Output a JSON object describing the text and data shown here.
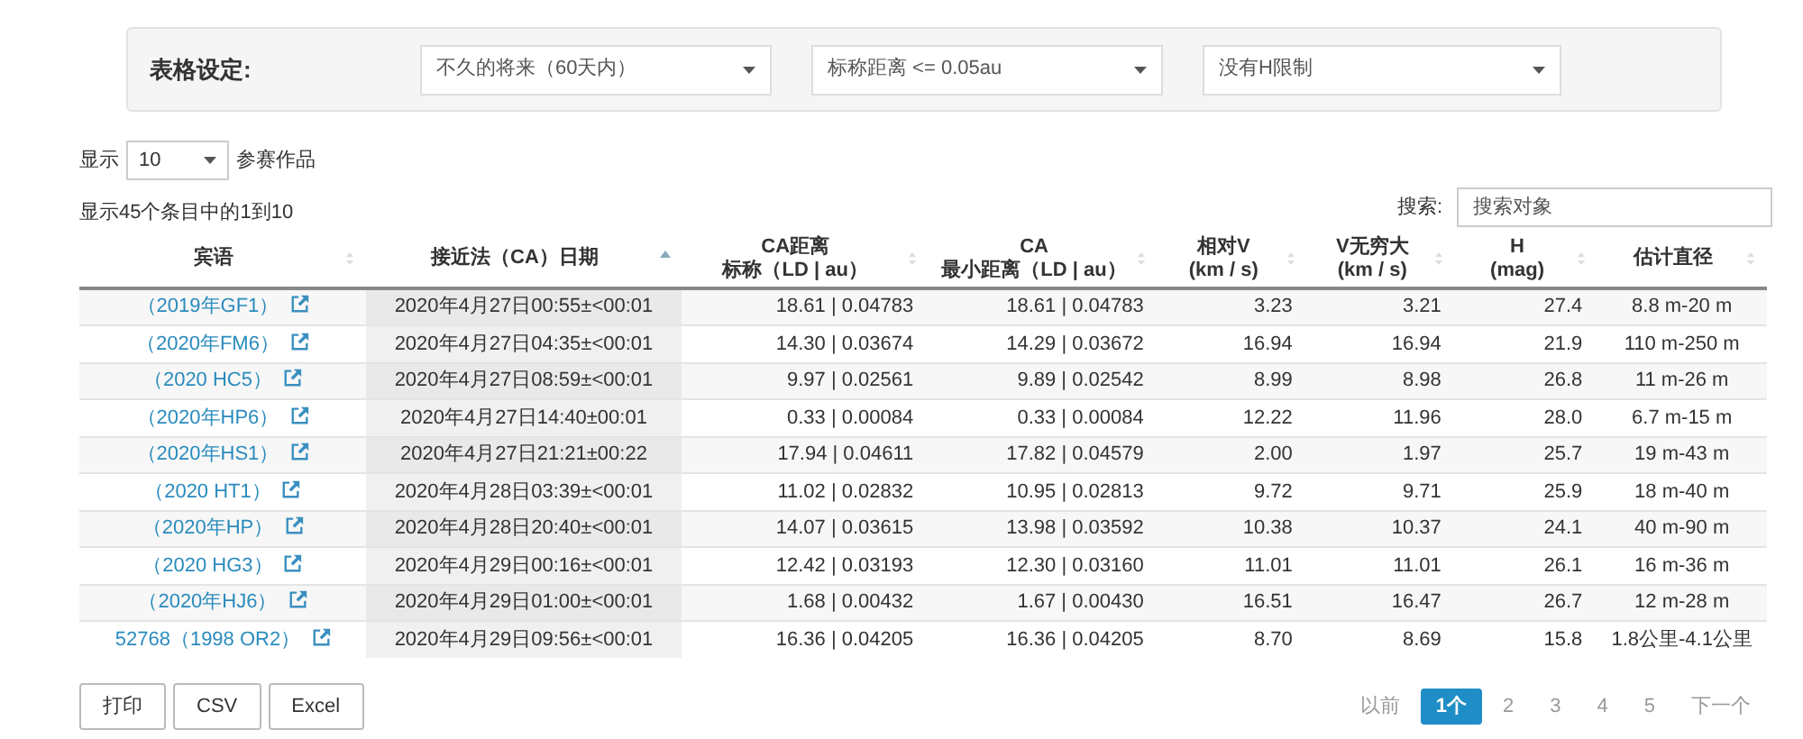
{
  "settings": {
    "label": "表格设定:",
    "selects": [
      {
        "value": "不久的将来（60天内）"
      },
      {
        "value": "标称距离 <= 0.05au"
      },
      {
        "value": "没有H限制"
      }
    ]
  },
  "length_menu": {
    "prefix": "显示",
    "value": "10",
    "suffix": "参赛作品"
  },
  "info": "显示45个条目中的1到10",
  "search": {
    "label": "搜索:",
    "placeholder": "搜索对象"
  },
  "table": {
    "columns": [
      {
        "lines": [
          "宾语"
        ],
        "sorted": false
      },
      {
        "lines": [
          "接近法（CA）日期"
        ],
        "sorted": true
      },
      {
        "lines": [
          "CA距离",
          "标称（LD | au）"
        ],
        "sorted": false
      },
      {
        "lines": [
          "CA",
          "最小距离（LD | au）"
        ],
        "sorted": false
      },
      {
        "lines": [
          "相对V",
          "(km / s)"
        ],
        "sorted": false
      },
      {
        "lines": [
          "V无穷大",
          "(km / s)"
        ],
        "sorted": false
      },
      {
        "lines": [
          "H",
          "(mag)"
        ],
        "sorted": false
      },
      {
        "lines": [
          "估计直径"
        ],
        "sorted": false
      }
    ],
    "rows": [
      [
        "（2019年GF1）",
        "2020年4月27日00:55±<00:01",
        "18.61 | 0.04783",
        "18.61 | 0.04783",
        "3.23",
        "3.21",
        "27.4",
        "8.8 m-20 m"
      ],
      [
        "（2020年FM6）",
        "2020年4月27日04:35±<00:01",
        "14.30 | 0.03674",
        "14.29 | 0.03672",
        "16.94",
        "16.94",
        "21.9",
        "110 m-250 m"
      ],
      [
        "（2020 HC5）",
        "2020年4月27日08:59±<00:01",
        "9.97 | 0.02561",
        "9.89 | 0.02542",
        "8.99",
        "8.98",
        "26.8",
        "11 m-26 m"
      ],
      [
        "（2020年HP6）",
        "2020年4月27日14:40±00:01",
        "0.33 | 0.00084",
        "0.33 | 0.00084",
        "12.22",
        "11.96",
        "28.0",
        "6.7 m-15 m"
      ],
      [
        "（2020年HS1）",
        "2020年4月27日21:21±00:22",
        "17.94 | 0.04611",
        "17.82 | 0.04579",
        "2.00",
        "1.97",
        "25.7",
        "19 m-43 m"
      ],
      [
        "（2020 HT1）",
        "2020年4月28日03:39±<00:01",
        "11.02 | 0.02832",
        "10.95 | 0.02813",
        "9.72",
        "9.71",
        "25.9",
        "18 m-40 m"
      ],
      [
        "（2020年HP）",
        "2020年4月28日20:40±<00:01",
        "14.07 | 0.03615",
        "13.98 | 0.03592",
        "10.38",
        "10.37",
        "24.1",
        "40 m-90 m"
      ],
      [
        "（2020 HG3）",
        "2020年4月29日00:16±<00:01",
        "12.42 | 0.03193",
        "12.30 | 0.03160",
        "11.01",
        "11.01",
        "26.1",
        "16 m-36 m"
      ],
      [
        "（2020年HJ6）",
        "2020年4月29日01:00±<00:01",
        "1.68 | 0.00432",
        "1.67 | 0.00430",
        "16.51",
        "16.47",
        "26.7",
        "12 m-28 m"
      ],
      [
        "52768（1998 OR2）",
        "2020年4月29日09:56±<00:01",
        "16.36 | 0.04205",
        "16.36 | 0.04205",
        "8.70",
        "8.69",
        "15.8",
        "1.8公里-4.1公里"
      ]
    ]
  },
  "buttons": [
    "打印",
    "CSV",
    "Excel"
  ],
  "pagination": {
    "previous": "以前",
    "pages": [
      {
        "label": "1个",
        "selected": true
      },
      {
        "label": "2",
        "selected": false
      },
      {
        "label": "3",
        "selected": false
      },
      {
        "label": "4",
        "selected": false
      },
      {
        "label": "5",
        "selected": false
      }
    ],
    "next": "下一个"
  }
}
